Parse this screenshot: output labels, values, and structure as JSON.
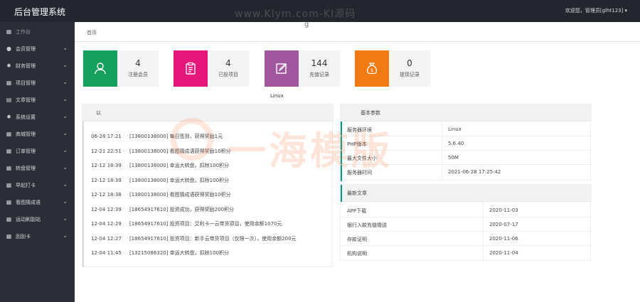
{
  "header": {
    "brand": "后台管理系统",
    "watermark": "www.Klym.com-KI源码",
    "user": "欢迎您，管理员[glht123]"
  },
  "sidebar": {
    "items": [
      {
        "label": "工作台",
        "icon": "grid-icon",
        "expandable": false
      },
      {
        "label": "会员管理",
        "icon": "user-circle-icon",
        "expandable": true
      },
      {
        "label": "财务管理",
        "icon": "gear-icon",
        "expandable": true
      },
      {
        "label": "项目管理",
        "icon": "grid-icon",
        "expandable": true
      },
      {
        "label": "文章管理",
        "icon": "document-icon",
        "expandable": true
      },
      {
        "label": "系统设置",
        "icon": "gear-icon",
        "expandable": true
      },
      {
        "label": "商城管理",
        "icon": "grid-icon",
        "expandable": true
      },
      {
        "label": "订单管理",
        "icon": "grid-icon",
        "expandable": true
      },
      {
        "label": "转盘管理",
        "icon": "grid-icon",
        "expandable": true
      },
      {
        "label": "早起打卡",
        "icon": "grid-icon",
        "expandable": true
      },
      {
        "label": "看图猜成语",
        "icon": "grid-icon",
        "expandable": true
      },
      {
        "label": "运动刷副站",
        "icon": "grid-icon",
        "expandable": true
      },
      {
        "label": "刮刮卡",
        "icon": "grid-icon",
        "expandable": true
      }
    ]
  },
  "breadcrumb": {
    "home": "首页",
    "ghost": "g"
  },
  "stats": [
    {
      "value": "4",
      "label": "注册会员",
      "color": "#16a05d",
      "icon": "user-icon"
    },
    {
      "value": "4",
      "label": "已投项目",
      "color": "#e6177a",
      "icon": "clipboard-icon"
    },
    {
      "value": "144",
      "label": "充值记录",
      "color": "#a0579e",
      "icon": "edit-icon"
    },
    {
      "value": "0",
      "label": "提现记录",
      "color": "#f17b12",
      "icon": "money-bag-icon"
    }
  ],
  "os": "Linux",
  "log": {
    "header": "以",
    "rows": [
      {
        "time": "06-28 17:21",
        "text": "[13800138000] 每日签到，获得奖励1元"
      },
      {
        "time": "12-21 22:51",
        "text": "[13800138000] 看图猜成语获得奖励10积分"
      },
      {
        "time": "12-12 18:39",
        "text": "[13800138000] 幸运大转盘，扣除100积分"
      },
      {
        "time": "12-12 18:39",
        "text": "[13800138000] 幸运大转盘，扣除100积分"
      },
      {
        "time": "12-12 18:38",
        "text": "[13800138000] 看图猜成语获得奖励10积分"
      },
      {
        "time": "12-04 12:39",
        "text": "[18654917610] 投资成功，获得奖励200积分"
      },
      {
        "time": "12-04 12:29",
        "text": "[18654917610] 投资项目：艾利卡一云带货项目，使用余额1070元"
      },
      {
        "time": "12-04 12:27",
        "text": "[18654917610] 投资项目：新手云带货项目（仅限一次），使用余额200元"
      },
      {
        "time": "12-04 11:45",
        "text": "[13215086320] 幸运大转盘，扣除100积分"
      }
    ]
  },
  "info": {
    "header": "基本参数",
    "rows": [
      {
        "key": "服务器环境",
        "value": "Linux"
      },
      {
        "key": "PHP版本",
        "value": "5.6.40"
      },
      {
        "key": "最大文件大小",
        "value": "50M"
      },
      {
        "key": "服务器时间",
        "value": "2021-06-28 17:25:42"
      }
    ]
  },
  "news": {
    "header": "最新文章",
    "rows": [
      {
        "title": "APP下载",
        "date": "2020-11-03"
      },
      {
        "title": "银行入款充值赠送",
        "date": "2020-07-17"
      },
      {
        "title": "存款证明",
        "date": "2020-11-06"
      },
      {
        "title": "机构说明",
        "date": "2020-11-04"
      }
    ]
  },
  "overlay_watermark": "一海模版"
}
